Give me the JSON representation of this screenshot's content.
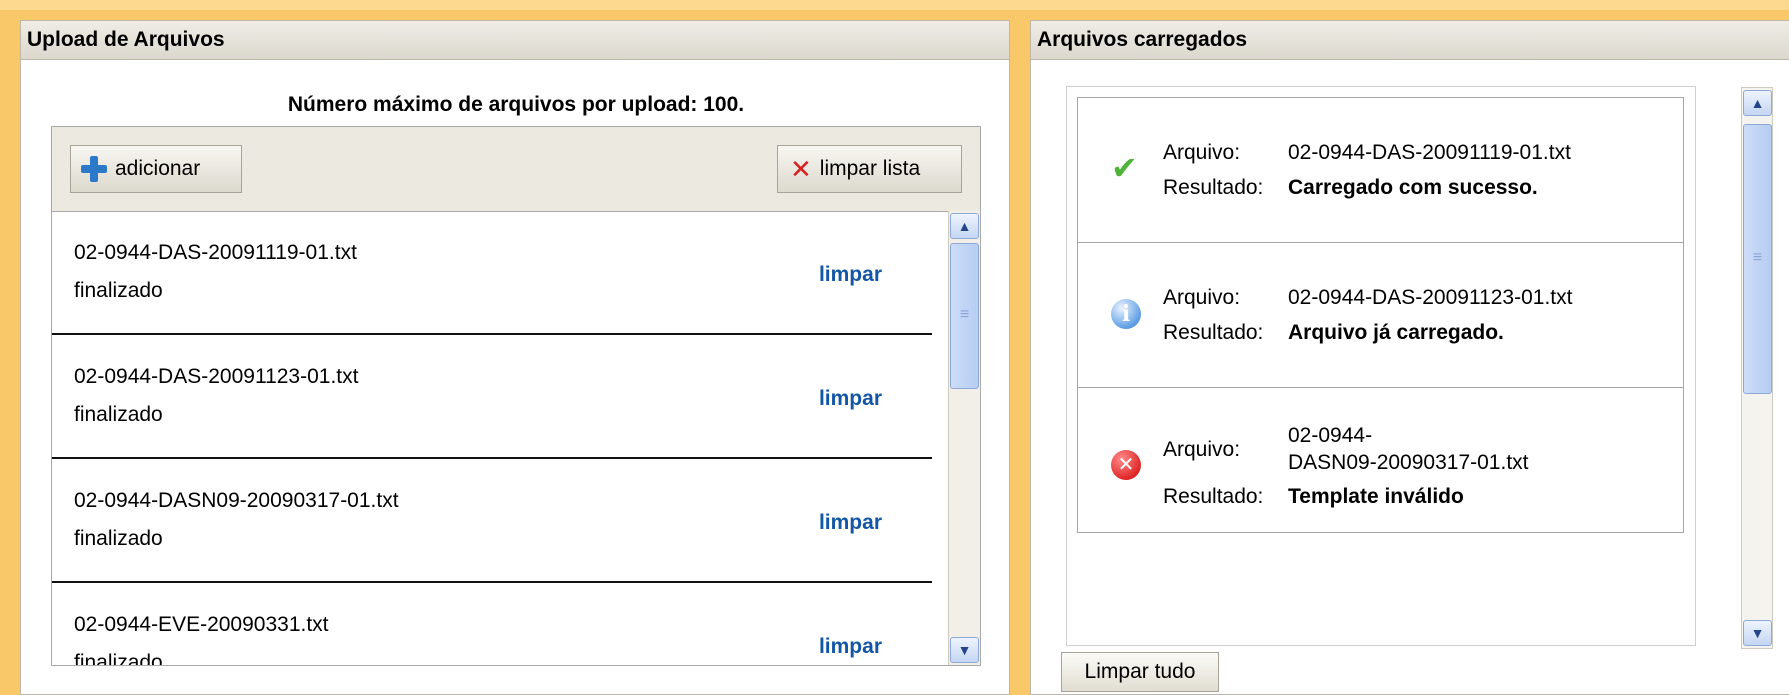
{
  "upload_panel": {
    "title": "Upload de Arquivos",
    "max_files_text": "Número máximo de arquivos por upload: 100.",
    "add_label": "adicionar",
    "clear_list_label": "limpar lista",
    "files": [
      {
        "name": "02-0944-DAS-20091119-01.txt",
        "status": "finalizado",
        "action": "limpar"
      },
      {
        "name": "02-0944-DAS-20091123-01.txt",
        "status": "finalizado",
        "action": "limpar"
      },
      {
        "name": "02-0944-DASN09-20090317-01.txt",
        "status": "finalizado",
        "action": "limpar"
      },
      {
        "name": "02-0944-EVE-20090331.txt",
        "status": "finalizado",
        "action": "limpar"
      }
    ]
  },
  "results_panel": {
    "title": "Arquivos carregados",
    "file_label": "Arquivo:",
    "result_label": "Resultado:",
    "results": [
      {
        "icon": "success-check-icon",
        "file": "02-0944-DAS-20091119-01.txt",
        "result": "Carregado com sucesso."
      },
      {
        "icon": "info-icon",
        "file": "02-0944-DAS-20091123-01.txt",
        "result": "Arquivo já carregado."
      },
      {
        "icon": "error-icon",
        "file_line1": "02-0944-",
        "file_line2": "DASN09-20090317-01.txt",
        "result": "Template inválido"
      }
    ],
    "clear_all_label": "Limpar tudo"
  },
  "colors": {
    "page_background": "#f9c868",
    "link_blue": "#1456a6",
    "success_green": "#4fb33a",
    "error_red": "#e02828"
  }
}
